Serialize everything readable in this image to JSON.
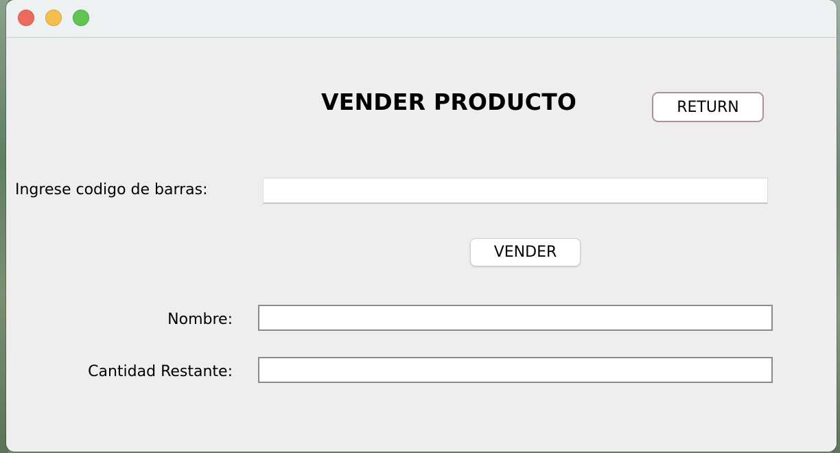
{
  "window": {
    "controls": {
      "close_icon": "close-traffic-light-icon",
      "minimize_icon": "minimize-traffic-light-icon",
      "maximize_icon": "maximize-traffic-light-icon"
    }
  },
  "header": {
    "title": "VENDER PRODUCTO",
    "return_label": "RETURN"
  },
  "form": {
    "barcode": {
      "label": "Ingrese codigo de barras:",
      "value": ""
    },
    "sell_label": "VENDER",
    "nombre": {
      "label": "Nombre:",
      "value": ""
    },
    "cantidad": {
      "label": "Cantidad Restante:",
      "value": ""
    }
  },
  "colors": {
    "window_background": "#eeeeee",
    "return_border": "#ab9197",
    "close": "#ec6a5e",
    "minimize": "#f4bf4f",
    "maximize": "#61c554"
  }
}
